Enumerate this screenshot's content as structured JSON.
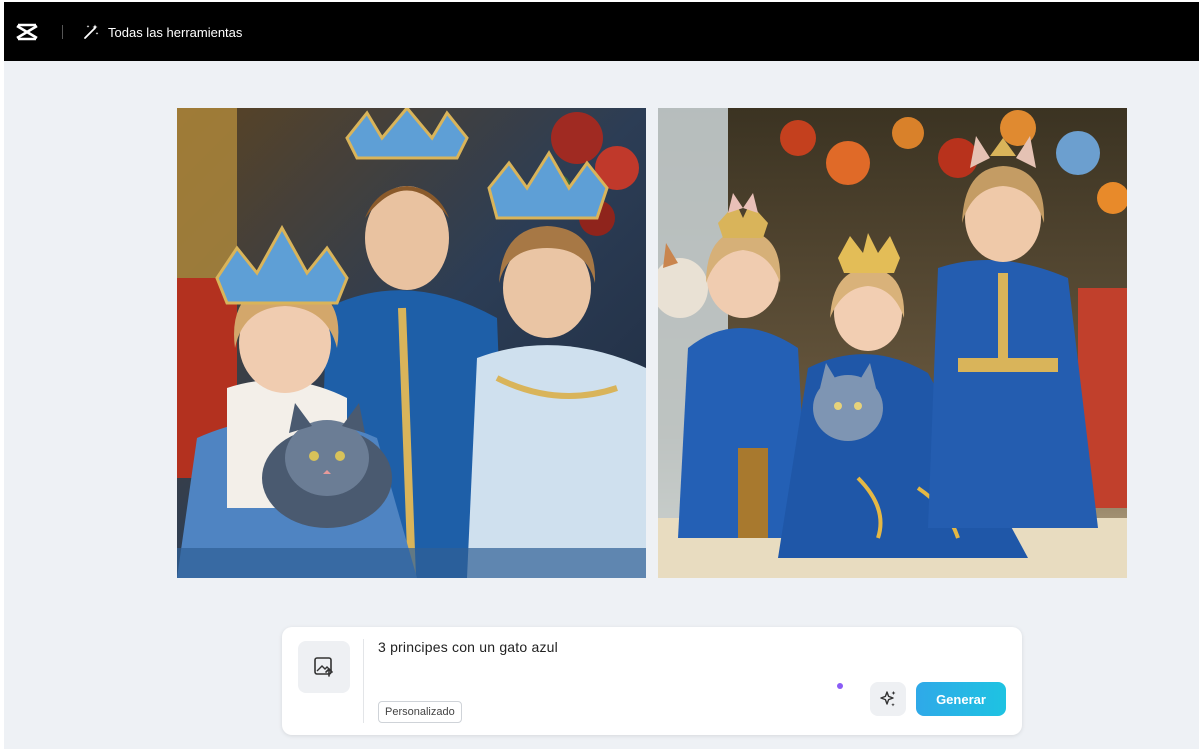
{
  "header": {
    "logo_icon": "capcut-logo-icon",
    "tools_icon": "magic-wand-icon",
    "tools_label": "Todas las herramientas"
  },
  "images": [
    {
      "name": "generated-image-1"
    },
    {
      "name": "generated-image-2"
    }
  ],
  "prompt_panel": {
    "upload_icon": "image-upload-icon",
    "prompt_text": "3  principes con un gato azul",
    "style_tag": "Personalizado",
    "magic_icon": "sparkle-icon",
    "generate_label": "Generar",
    "accent_color": "#22b5e6",
    "dot_color": "#8a5cf6"
  }
}
